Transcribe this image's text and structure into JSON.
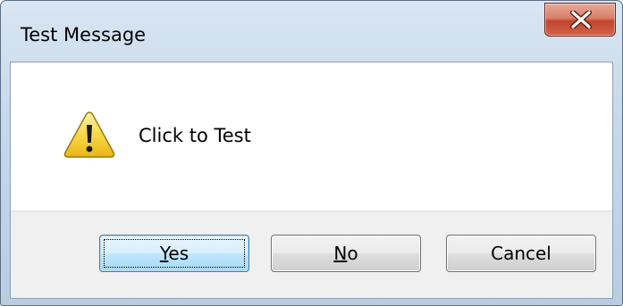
{
  "window": {
    "title": "Test Message",
    "close_icon": "close-x-icon"
  },
  "message": {
    "icon": "warning-icon",
    "text": "Click to Test"
  },
  "buttons": {
    "yes": {
      "access_key": "Y",
      "rest": "es"
    },
    "no": {
      "access_key": "N",
      "rest": "o"
    },
    "cancel": {
      "label": "Cancel"
    }
  },
  "colors": {
    "close_button": "#c2452c",
    "warning_yellow": "#f5c526",
    "default_button_border": "#3c7fb1"
  }
}
